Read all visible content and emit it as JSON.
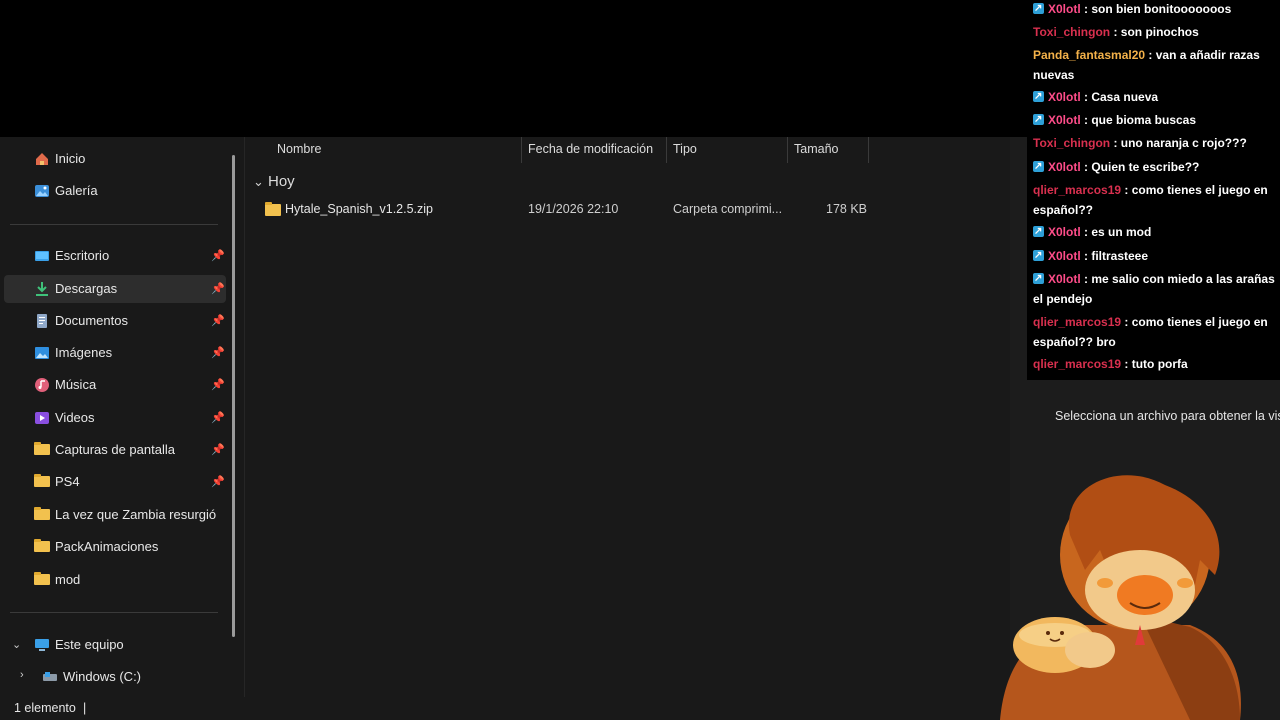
{
  "sidebar": {
    "items": [
      {
        "label": "Inicio",
        "icon": "home-icon",
        "pinned": false
      },
      {
        "label": "Galería",
        "icon": "gallery-icon",
        "pinned": false
      },
      {
        "label": "Escritorio",
        "icon": "desktop-icon",
        "pinned": true
      },
      {
        "label": "Descargas",
        "icon": "download-icon",
        "pinned": true,
        "selected": true
      },
      {
        "label": "Documentos",
        "icon": "documents-icon",
        "pinned": true
      },
      {
        "label": "Imágenes",
        "icon": "pictures-icon",
        "pinned": true
      },
      {
        "label": "Música",
        "icon": "music-icon",
        "pinned": true
      },
      {
        "label": "Videos",
        "icon": "videos-icon",
        "pinned": true
      },
      {
        "label": "Capturas de pantalla",
        "icon": "folder-icon",
        "pinned": true
      },
      {
        "label": "PS4",
        "icon": "folder-icon",
        "pinned": true
      },
      {
        "label": "La vez que Zambia resurgió",
        "icon": "folder-icon",
        "pinned": false
      },
      {
        "label": "PackAnimaciones",
        "icon": "folder-icon",
        "pinned": false
      },
      {
        "label": "mod",
        "icon": "folder-icon",
        "pinned": false
      }
    ],
    "this_pc": {
      "label": "Este equipo",
      "icon": "computer-icon"
    },
    "drive": {
      "label": "Windows (C:)",
      "icon": "drive-icon"
    }
  },
  "columns": {
    "name": "Nombre",
    "modified": "Fecha de modificación",
    "type": "Tipo",
    "size": "Tamaño"
  },
  "group": {
    "label": "Hoy"
  },
  "files": [
    {
      "name": "Hytale_Spanish_v1.2.5.zip",
      "modified": "19/1/2026 22:10",
      "type": "Carpeta comprimi...",
      "size": "178 KB",
      "icon": "zip-folder-icon"
    }
  ],
  "status": {
    "count": "1 elemento"
  },
  "preview": {
    "text": "Selecciona un archivo para obtener la vista"
  },
  "chat": {
    "messages": [
      {
        "user": "X0lotl",
        "text": ": son bien bonitooooooos",
        "color": "#ff4d8a",
        "badge": true
      },
      {
        "user": "Toxi_chingon",
        "text": ": son pinochos",
        "color": "#d9304f",
        "badge": false
      },
      {
        "user": "Panda_fantasmal20",
        "text": ": van a añadir razas nuevas",
        "color": "#f4b24a",
        "badge": false
      },
      {
        "user": "X0lotl",
        "text": ": Casa nueva",
        "color": "#ff4d8a",
        "badge": true
      },
      {
        "user": "X0lotl",
        "text": ": que bioma buscas",
        "color": "#ff4d8a",
        "badge": true
      },
      {
        "user": "Toxi_chingon",
        "text": ": uno naranja c rojo???",
        "color": "#d9304f",
        "badge": false
      },
      {
        "user": "X0lotl",
        "text": ": Quien te escribe??",
        "color": "#ff4d8a",
        "badge": true
      },
      {
        "user": "qlier_marcos19",
        "text": ": como tienes el juego en español??",
        "color": "#d9304f",
        "badge": false
      },
      {
        "user": "X0lotl",
        "text": ": es un mod",
        "color": "#ff4d8a",
        "badge": true
      },
      {
        "user": "X0lotl",
        "text": ": filtrasteee",
        "color": "#ff4d8a",
        "badge": true
      },
      {
        "user": "X0lotl",
        "text": ": me salio con miedo a las arañas el pendejo",
        "color": "#ff4d8a",
        "badge": true
      },
      {
        "user": "qlier_marcos19",
        "text": ": como tienes el juego en español?? bro",
        "color": "#d9304f",
        "badge": false
      },
      {
        "user": "qlier_marcos19",
        "text": ": tuto porfa",
        "color": "#d9304f",
        "badge": false
      }
    ]
  }
}
